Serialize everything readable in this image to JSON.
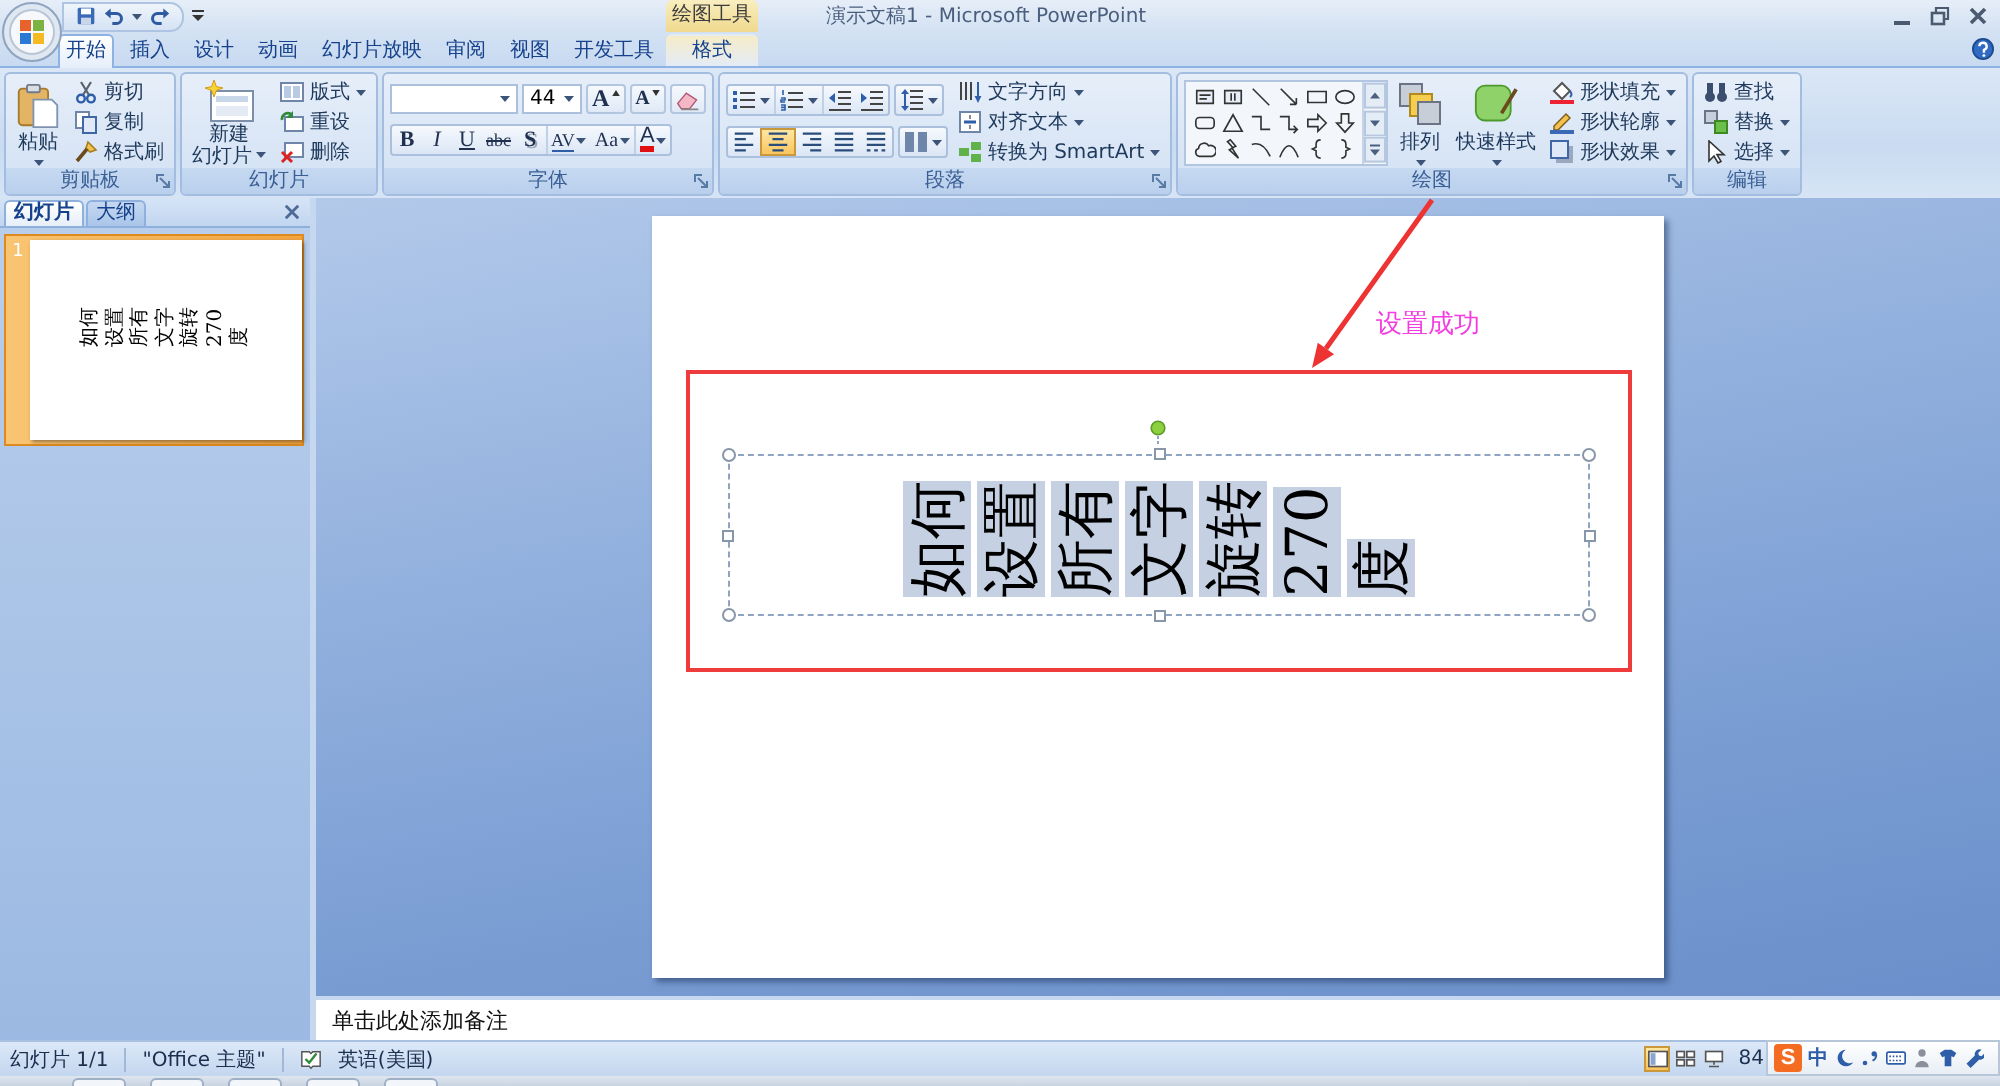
{
  "window": {
    "title": "演示文稿1 - Microsoft PowerPoint",
    "contextual_group": "绘图工具"
  },
  "tabs": [
    {
      "label": "开始",
      "selected": true,
      "kind": "standard"
    },
    {
      "label": "插入",
      "selected": false,
      "kind": "standard"
    },
    {
      "label": "设计",
      "selected": false,
      "kind": "standard"
    },
    {
      "label": "动画",
      "selected": false,
      "kind": "standard"
    },
    {
      "label": "幻灯片放映",
      "selected": false,
      "kind": "standard"
    },
    {
      "label": "审阅",
      "selected": false,
      "kind": "standard"
    },
    {
      "label": "视图",
      "selected": false,
      "kind": "standard"
    },
    {
      "label": "开发工具",
      "selected": false,
      "kind": "standard"
    },
    {
      "label": "格式",
      "selected": false,
      "kind": "contextual"
    }
  ],
  "ribbon": {
    "clipboard": {
      "label": "剪贴板",
      "launcher": true,
      "paste": "粘贴",
      "cut": "剪切",
      "copy": "复制",
      "format_painter": "格式刷"
    },
    "slides": {
      "label": "幻灯片",
      "launcher": false,
      "new_slide": [
        "新建",
        "幻灯片"
      ],
      "layout": "版式",
      "reset": "重设",
      "delete": "删除"
    },
    "font": {
      "label": "字体",
      "launcher": true,
      "size": "44",
      "grow": "A",
      "shrink": "A",
      "buttons": [
        {
          "label": "B",
          "dropdown": false
        },
        {
          "label": "I",
          "dropdown": false
        },
        {
          "label": "U",
          "dropdown": false
        },
        {
          "label": "abc",
          "dropdown": false
        },
        {
          "label": "S",
          "dropdown": false
        },
        {
          "label": "AV",
          "dropdown": true
        },
        {
          "label": "Aa",
          "dropdown": true
        },
        {
          "label": "A",
          "dropdown": true
        }
      ]
    },
    "paragraph": {
      "label": "段落",
      "launcher": true,
      "text_direction": "文字方向",
      "align_text": "对齐文本",
      "smartart": "转换为 SmartArt",
      "align": [
        {
          "selected": false
        },
        {
          "selected": true
        },
        {
          "selected": false
        },
        {
          "selected": false
        },
        {
          "selected": false
        }
      ]
    },
    "drawing": {
      "label": "绘图",
      "launcher": true,
      "arrange": "排列",
      "quick_styles": "快速样式",
      "fill": "形状填充",
      "outline": "形状轮廓",
      "effects": "形状效果"
    },
    "editing": {
      "label": "编辑",
      "launcher": false,
      "find": "查找",
      "replace": "替换",
      "select": "选择"
    }
  },
  "slide_pane": {
    "tabs": [
      {
        "label": "幻灯片",
        "selected": true
      },
      {
        "label": "大纲",
        "selected": false
      }
    ],
    "thumbnails": [
      {
        "number": "1",
        "selected": true,
        "text": "如何设置所有文字旋转270度"
      }
    ]
  },
  "slide": {
    "textbox": {
      "text": "如何设置所有文字旋转270度",
      "selected": true,
      "highlighted": true
    }
  },
  "annotation": {
    "label": "设置成功"
  },
  "notes": {
    "placeholder": "单击此处添加备注"
  },
  "status_bar": {
    "slide": "幻灯片 1/1",
    "theme": "\"Office 主题\"",
    "language": "英语(美国)",
    "views": [
      {
        "selected": true
      },
      {
        "selected": false
      },
      {
        "selected": false
      }
    ],
    "zoom": "84"
  },
  "ime_bar": {
    "logo": "S",
    "mode": "中"
  }
}
